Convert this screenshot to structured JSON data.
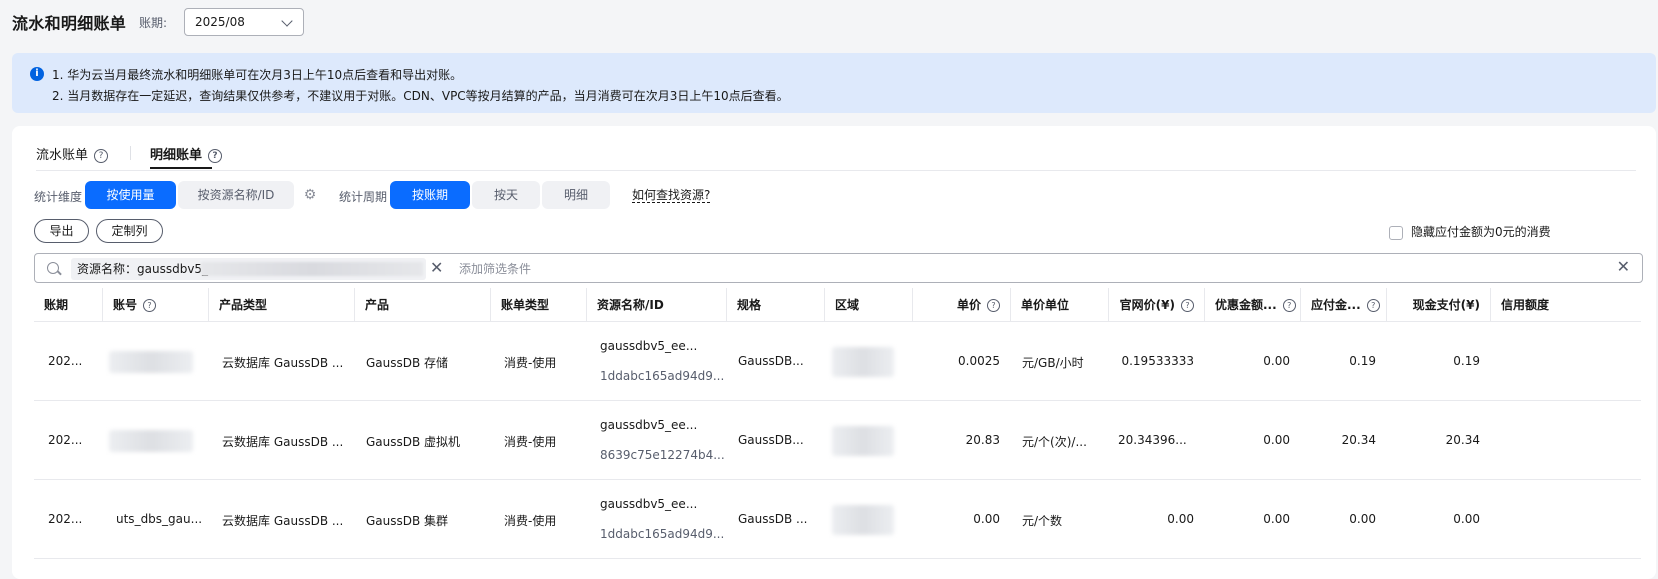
{
  "header": {
    "title": "流水和明细账单",
    "period_label": "账期:",
    "period_value": "2025/08"
  },
  "notice": {
    "line1": "1. 华为云当月最终流水和明细账单可在次月3日上午10点后查看和导出对账。",
    "line2": "2. 当月数据存在一定延迟，查询结果仅供参考，不建议用于对账。CDN、VPC等按月结算的产品，当月消费可在次月3日上午10点后查看。"
  },
  "tabs": [
    {
      "label": "流水账单",
      "active": false
    },
    {
      "label": "明细账单",
      "active": true
    }
  ],
  "filters": {
    "dimension_label": "统计维度",
    "dimension_options": [
      "按使用量",
      "按资源名称/ID"
    ],
    "cycle_label": "统计周期",
    "cycle_options": [
      "按账期",
      "按天",
      "明细"
    ],
    "howto_link": "如何查找资源?"
  },
  "actions": {
    "export": "导出",
    "customize": "定制列",
    "hide_zero": "隐藏应付金额为0元的消费"
  },
  "search": {
    "chip": "资源名称：gaussdbv5_ee",
    "placeholder": "添加筛选条件"
  },
  "columns": [
    "账期",
    "账号",
    "产品类型",
    "产品",
    "账单类型",
    "资源名称/ID",
    "规格",
    "区域",
    "单价",
    "单价单位",
    "官网价(¥)",
    "优惠金额...",
    "应付金...",
    "现金支付(¥)",
    "信用额度"
  ],
  "rows": [
    {
      "period": "202...",
      "account": "",
      "product_type": "云数据库 GaussDB ...",
      "product": "GaussDB 存储",
      "bill_type": "消费-使用",
      "res_name": "gaussdbv5_ee...",
      "res_id": "1ddabc165ad94d9...",
      "spec": "GaussDB...",
      "unit_price": "0.0025",
      "price_unit": "元/GB/小时",
      "list_price": "0.19533333",
      "discount": "0.00",
      "payable": "0.19",
      "cash": "0.19"
    },
    {
      "period": "202...",
      "account": "",
      "product_type": "云数据库 GaussDB ...",
      "product": "GaussDB 虚拟机",
      "bill_type": "消费-使用",
      "res_name": "gaussdbv5_ee...",
      "res_id": "8639c75e12274b4...",
      "spec": "GaussDB...",
      "unit_price": "20.83",
      "price_unit": "元/个(次)/...",
      "list_price": "20.34396...",
      "discount": "0.00",
      "payable": "20.34",
      "cash": "20.34"
    },
    {
      "period": "202...",
      "account": "uts_dbs_gau...",
      "product_type": "云数据库 GaussDB ...",
      "product": "GaussDB 集群",
      "bill_type": "消费-使用",
      "res_name": "gaussdbv5_ee...",
      "res_id": "1ddabc165ad94d9...",
      "spec": "GaussDB ...",
      "unit_price": "0.00",
      "price_unit": "元/个数",
      "list_price": "0.00",
      "discount": "0.00",
      "payable": "0.00",
      "cash": "0.00"
    }
  ]
}
